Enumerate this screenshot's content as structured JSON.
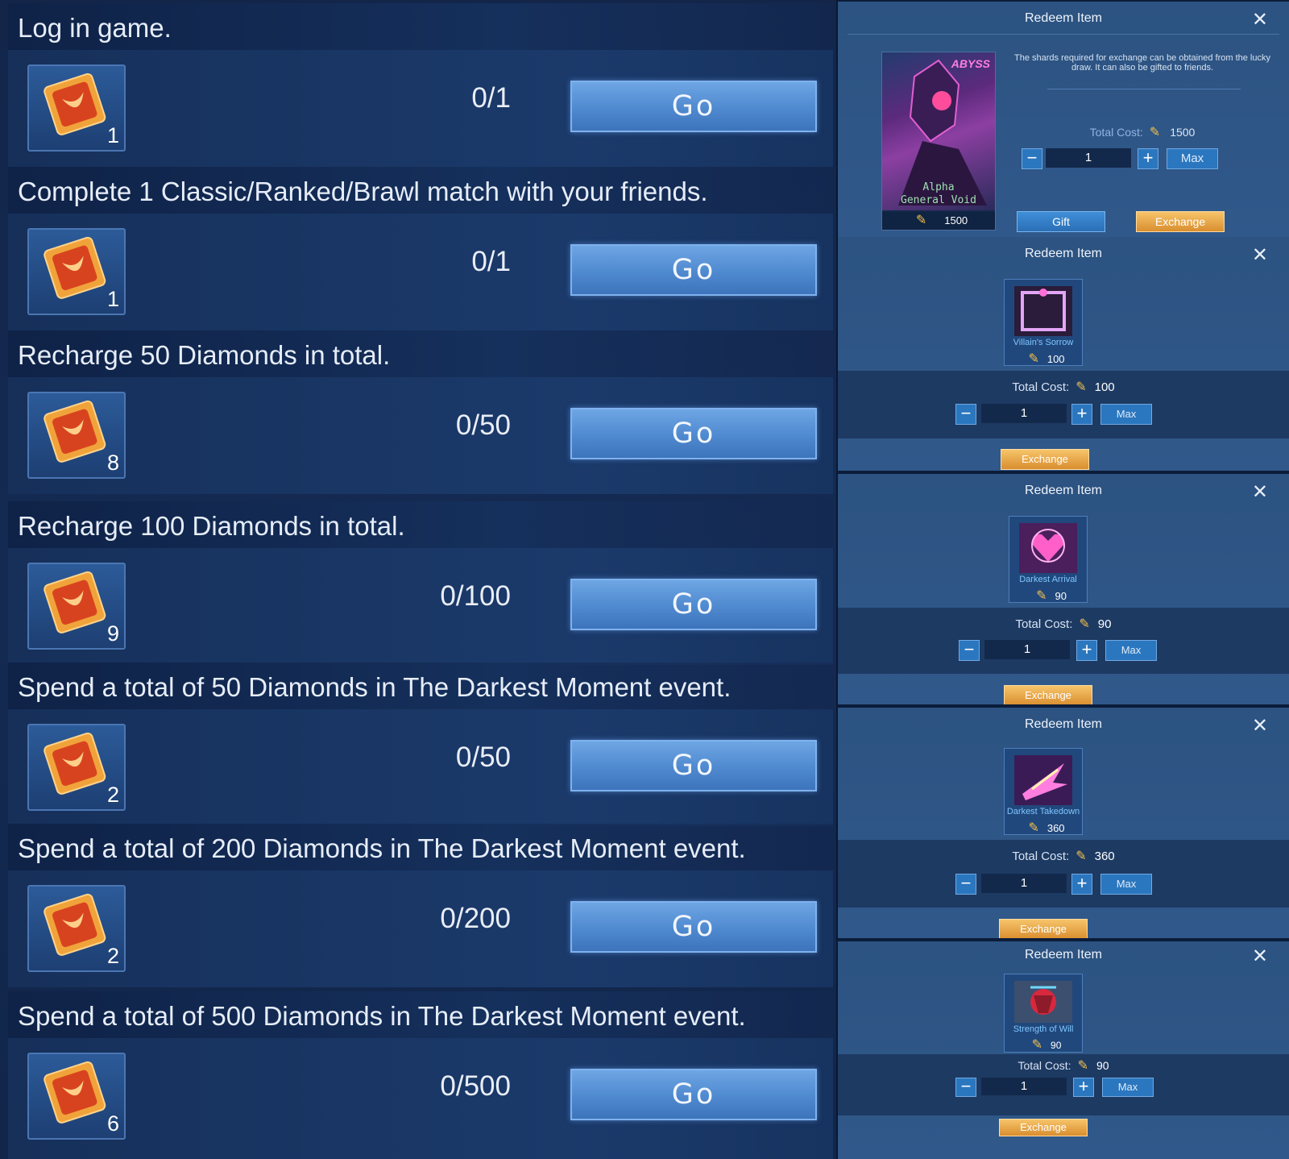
{
  "tasks": [
    {
      "title": "Log in game.",
      "reward_qty": "1",
      "progress": "0/1",
      "button": "Go"
    },
    {
      "title": "Complete 1 Classic/Ranked/Brawl match with your friends.",
      "reward_qty": "1",
      "progress": "0/1",
      "button": "Go"
    },
    {
      "title": "Recharge 50 Diamonds in total.",
      "reward_qty": "8",
      "progress": "0/50",
      "button": "Go"
    },
    {
      "title": "Recharge 100 Diamonds in total.",
      "reward_qty": "9",
      "progress": "0/100",
      "button": "Go"
    },
    {
      "title": "Spend a total of 50 Diamonds in The Darkest Moment event.",
      "reward_qty": "2",
      "progress": "0/50",
      "button": "Go"
    },
    {
      "title": "Spend a total of 200 Diamonds in The Darkest Moment event.",
      "reward_qty": "2",
      "progress": "0/200",
      "button": "Go"
    },
    {
      "title": "Spend a total of 500 Diamonds in The Darkest Moment event.",
      "reward_qty": "6",
      "progress": "0/500",
      "button": "Go"
    }
  ],
  "redeem_panels": [
    {
      "title": "Redeem Item",
      "skin_badge": "ABYSS",
      "skin_name_line1": "Alpha",
      "skin_name_line2": "General Void",
      "skin_price": "1500",
      "description": "The shards required for exchange can be obtained from the lucky draw. It can also be gifted to friends.",
      "total_cost_label": "Total Cost:",
      "total_cost_value": "1500",
      "quantity": "1",
      "max_label": "Max",
      "gift_label": "Gift",
      "exchange_label": "Exchange"
    },
    {
      "title": "Redeem Item",
      "item_name": "Villain's Sorrow",
      "item_price": "100",
      "total_cost_label": "Total Cost:",
      "total_cost_value": "100",
      "quantity": "1",
      "max_label": "Max",
      "exchange_label": "Exchange"
    },
    {
      "title": "Redeem Item",
      "item_name": "Darkest Arrival",
      "item_price": "90",
      "total_cost_label": "Total Cost:",
      "total_cost_value": "90",
      "quantity": "1",
      "max_label": "Max",
      "exchange_label": "Exchange"
    },
    {
      "title": "Redeem Item",
      "item_name": "Darkest Takedown",
      "item_price": "360",
      "total_cost_label": "Total Cost:",
      "total_cost_value": "360",
      "quantity": "1",
      "max_label": "Max",
      "exchange_label": "Exchange"
    },
    {
      "title": "Redeem Item",
      "item_name": "Strength of Will",
      "item_price": "90",
      "total_cost_label": "Total Cost:",
      "total_cost_value": "90",
      "quantity": "1",
      "max_label": "Max",
      "exchange_label": "Exchange"
    }
  ],
  "colors": {
    "go_button": "#5a93d6",
    "exchange_button": "#e7a542",
    "panel_bg": "#2c5381",
    "task_bg": "#16305a"
  },
  "icons": {
    "reward": "shard-ticket-icon",
    "currency": "feather-shard-icon",
    "close": "close-icon"
  }
}
